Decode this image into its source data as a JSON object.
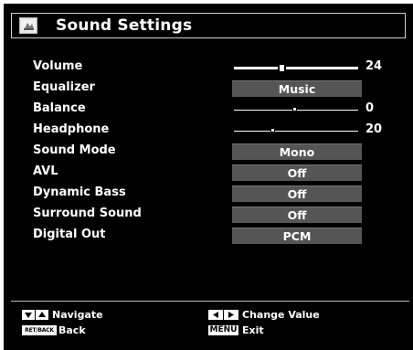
{
  "menu": {
    "title": "Sound Settings",
    "title_icon": "sound-settings-icon",
    "items": [
      {
        "label": "Volume",
        "type": "slider",
        "value": "24",
        "level": 0.4
      },
      {
        "label": "Equalizer",
        "type": "option",
        "value": "Music"
      },
      {
        "label": "Balance",
        "type": "slider",
        "value": "0",
        "level": 0.5
      },
      {
        "label": "Headphone",
        "type": "slider",
        "value": "20",
        "level": 0.32
      },
      {
        "label": "Sound Mode",
        "type": "option",
        "value": "Mono"
      },
      {
        "label": "AVL",
        "type": "option",
        "value": "Off"
      },
      {
        "label": "Dynamic Bass",
        "type": "option",
        "value": "Off"
      },
      {
        "label": "Surround Sound",
        "type": "option",
        "value": "Off"
      },
      {
        "label": "Digital Out",
        "type": "option",
        "value": "PCM"
      }
    ]
  },
  "footer": {
    "navigate_label": "Navigate",
    "back_key": "RET/BACK",
    "back_label": "Back",
    "change_label": "Change Value",
    "menu_key": "MENU",
    "exit_label": "Exit"
  },
  "colors": {
    "background": "#000000",
    "value_box": "#555555",
    "text": "#ffffff"
  }
}
